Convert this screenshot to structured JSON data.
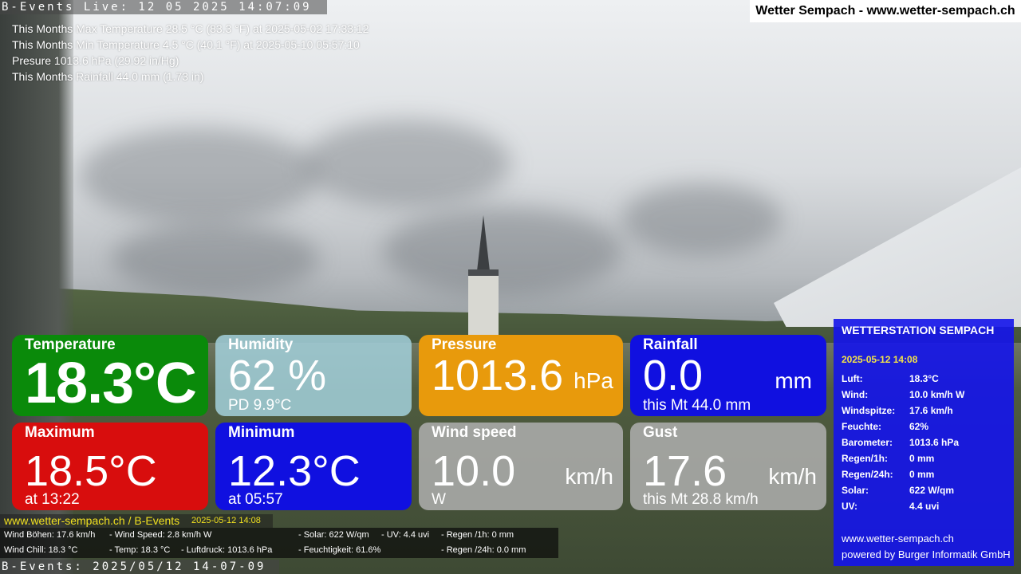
{
  "overlay": {
    "top_banner": "B-Events Live: 12 05 2025 14:07:09",
    "title": "Wetter Sempach - www.wetter-sempach.ch",
    "info_lines": [
      "This Months Max Temperature 28.5 °C (83.3 °F) at 2025-05-02 17:33:12",
      "This Months Min Temperature 4.5 °C (40.1 °F) at 2025-05-10 05:57:10",
      "Presure 1013.6 hPa (29.92 in/Hg)",
      "This Months Rainfall 44.0 mm (1.73 in)"
    ],
    "bottom_banner": "B-Events: 2025/05/12 14-07-09"
  },
  "tiles": {
    "temperature": {
      "label": "Temperature",
      "value": "18.3°C"
    },
    "humidity": {
      "label": "Humidity",
      "value": "62 %",
      "sub": "PD 9.9°C"
    },
    "pressure": {
      "label": "Pressure",
      "value": "1013.6",
      "unit": "hPa"
    },
    "rainfall": {
      "label": "Rainfall",
      "value": "0.0",
      "unit": "mm",
      "sub": "this Mt 44.0 mm"
    },
    "maximum": {
      "label": "Maximum",
      "value": "18.5°C",
      "sub": "at 13:22"
    },
    "minimum": {
      "label": "Minimum",
      "value": "12.3°C",
      "sub": "at 05:57"
    },
    "windspeed": {
      "label": "Wind speed",
      "value": "10.0",
      "unit": "km/h",
      "sub": "W"
    },
    "gust": {
      "label": "Gust",
      "value": "17.6",
      "unit": "km/h",
      "sub": "this Mt 28.8 km/h"
    }
  },
  "panel": {
    "title": "WETTERSTATION SEMPACH",
    "date": "2025-05-12 14:08",
    "rows": [
      {
        "k": "Luft:",
        "v": "18.3°C"
      },
      {
        "k": "Wind:",
        "v": "10.0 km/h  W"
      },
      {
        "k": "Windspitze:",
        "v": "17.6 km/h"
      },
      {
        "k": "Feuchte:",
        "v": "62%"
      },
      {
        "k": "Barometer:",
        "v": "1013.6 hPa"
      },
      {
        "k": "Regen/1h:",
        "v": "0 mm"
      },
      {
        "k": "Regen/24h:",
        "v": "0 mm"
      },
      {
        "k": "Solar:",
        "v": "622 W/qm"
      },
      {
        "k": "UV:",
        "v": "4.4 uvi"
      }
    ],
    "site": "www.wetter-sempach.ch",
    "powered": "powered by Burger Informatik GmbH"
  },
  "ticker": {
    "site": "www.wetter-sempach.ch / B-Events",
    "timestamp": "2025-05-12 14:08",
    "line1": [
      "Wind Böhen: 17.6 km/h",
      "- Wind Speed: 2.8 km/h W",
      "- Solar: 622 W/qm",
      "- UV: 4.4 uvi",
      "- Regen /1h:   0 mm"
    ],
    "line2": [
      "Wind Chill: 18.3 °C",
      "- Temp: 18.3 °C",
      "- Luftdruck: 1013.6 hPa",
      "- Feuchtigkeit: 61.6%",
      "- Regen /24h: 0.0 mm"
    ]
  }
}
